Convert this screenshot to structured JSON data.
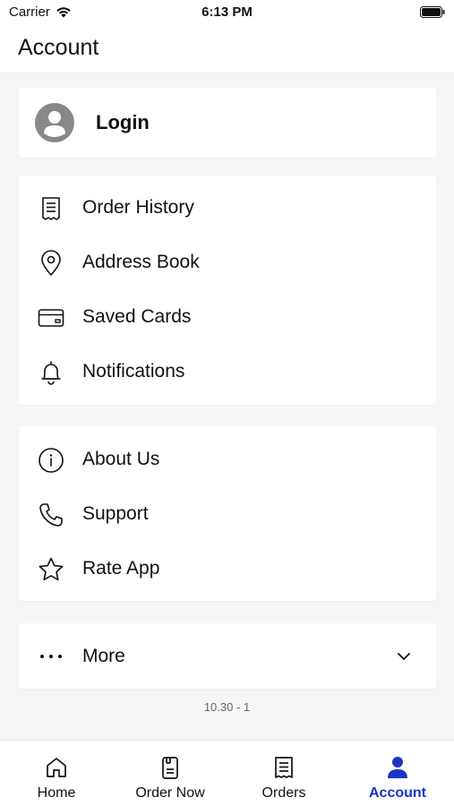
{
  "status_bar": {
    "carrier": "Carrier",
    "time": "6:13 PM"
  },
  "header": {
    "title": "Account"
  },
  "login": {
    "label": "Login"
  },
  "group_1": [
    {
      "label": "Order History",
      "icon": "receipt-icon"
    },
    {
      "label": "Address Book",
      "icon": "location-pin-icon"
    },
    {
      "label": "Saved Cards",
      "icon": "credit-card-icon"
    },
    {
      "label": "Notifications",
      "icon": "bell-icon"
    }
  ],
  "group_2": [
    {
      "label": "About Us",
      "icon": "info-icon"
    },
    {
      "label": "Support",
      "icon": "phone-icon"
    },
    {
      "label": "Rate App",
      "icon": "star-icon"
    }
  ],
  "more": {
    "label": "More",
    "icon": "ellipsis-icon"
  },
  "version": "10.30 - 1",
  "tabs": [
    {
      "label": "Home",
      "icon": "home-icon",
      "active": false
    },
    {
      "label": "Order Now",
      "icon": "order-now-icon",
      "active": false
    },
    {
      "label": "Orders",
      "icon": "receipt-icon",
      "active": false
    },
    {
      "label": "Account",
      "icon": "person-icon",
      "active": true
    }
  ],
  "colors": {
    "accent": "#1a36c4",
    "background": "#f6f6f6",
    "avatar": "#888888"
  }
}
